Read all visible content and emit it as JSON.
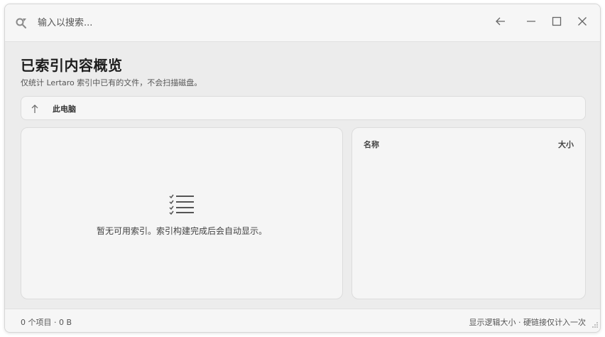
{
  "search": {
    "placeholder": "输入以搜索...",
    "value": "",
    "icon": "search-icon"
  },
  "window_controls": {
    "back_icon": "arrow-left-icon",
    "minimize_icon": "minimize-icon",
    "maximize_icon": "maximize-icon",
    "close_icon": "close-icon"
  },
  "page": {
    "title": "已索引内容概览",
    "subtitle": "仅统计 Lertaro 索引中已有的文件，不会扫描磁盘。"
  },
  "breadcrumb": {
    "up_icon": "arrow-up-icon",
    "label": "此电脑"
  },
  "left_panel": {
    "empty_icon": "checklist-icon",
    "empty_text": "暂无可用索引。索引构建完成后会自动显示。"
  },
  "right_panel": {
    "columns": {
      "name": "名称",
      "size": "大小"
    },
    "rows": []
  },
  "statusbar": {
    "left": "0 个项目 · 0 B",
    "right": "显示逻辑大小 · 硬链接仅计入一次"
  }
}
